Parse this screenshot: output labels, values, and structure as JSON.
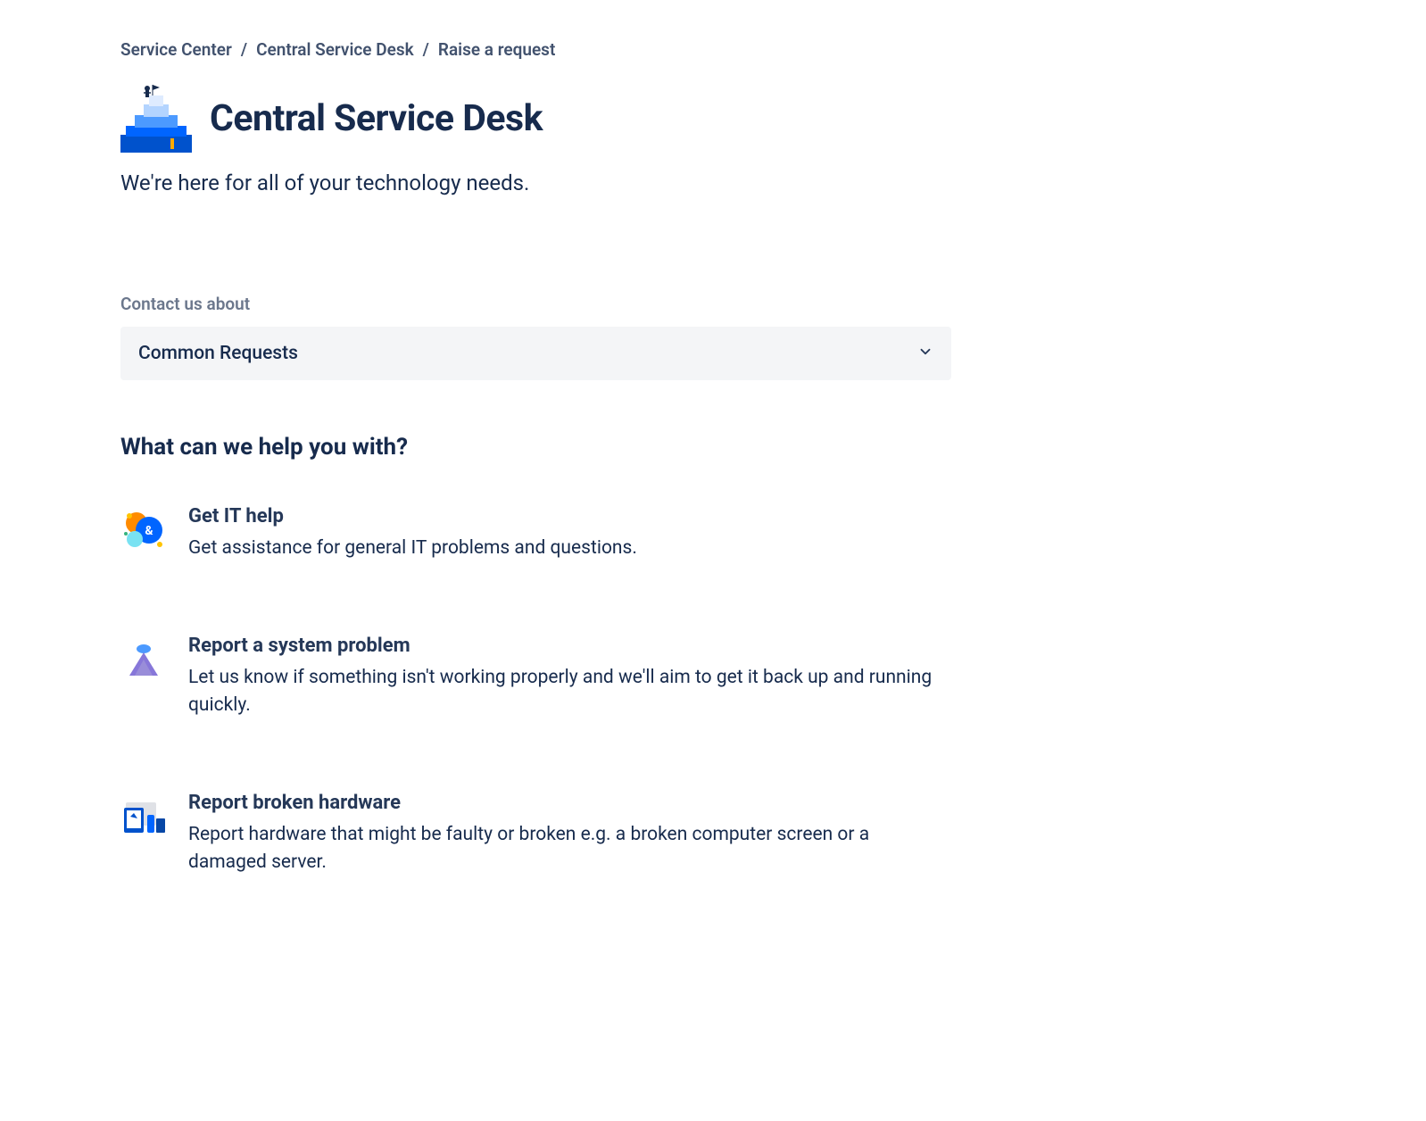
{
  "breadcrumb": {
    "items": [
      {
        "label": "Service Center"
      },
      {
        "label": "Central Service Desk"
      },
      {
        "label": "Raise a request"
      }
    ]
  },
  "header": {
    "title": "Central Service Desk",
    "tagline": "We're here for all of your technology needs."
  },
  "contact": {
    "label": "Contact us about",
    "selected": "Common Requests"
  },
  "help": {
    "heading": "What can we help you with?",
    "items": [
      {
        "title": "Get IT help",
        "description": "Get assistance for general IT problems and questions.",
        "icon": "chat-help-icon"
      },
      {
        "title": "Report a system problem",
        "description": "Let us know if something isn't working properly and we'll aim to get it back up and running quickly.",
        "icon": "system-alert-icon"
      },
      {
        "title": "Report broken hardware",
        "description": "Report hardware that might be faulty or broken e.g. a broken computer screen or a damaged server.",
        "icon": "devices-icon"
      }
    ]
  },
  "colors": {
    "primary": "#0052CC",
    "text": "#172B4D",
    "muted": "#6B778C",
    "dropdownBg": "#F4F5F7"
  }
}
